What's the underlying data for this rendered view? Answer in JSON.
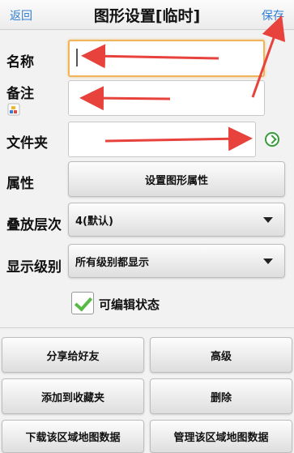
{
  "header": {
    "back_label": "返回",
    "title": "图形设置[临时]",
    "save_label": "保存"
  },
  "form": {
    "name": {
      "label": "名称",
      "value": ""
    },
    "note": {
      "label": "备注",
      "value": "",
      "icon": "note-edit-icon"
    },
    "folder": {
      "label": "文件夹",
      "value": "",
      "go_icon": "green-circle-arrow-right-icon"
    },
    "attributes": {
      "label": "属性",
      "button_label": "设置图形属性"
    },
    "layer_order": {
      "label": "叠放层次",
      "selected": "4(默认)"
    },
    "display_level": {
      "label": "显示级别",
      "selected": "所有级别都显示"
    },
    "editable": {
      "label": "可编辑状态",
      "checked": true
    }
  },
  "actions": {
    "share": "分享给好友",
    "advanced": "高级",
    "favorite": "添加到收藏夹",
    "delete": "删除",
    "download": "下载该区域地图数据",
    "manage": "管理该区域地图数据"
  },
  "annotation_color": "#e8423c"
}
